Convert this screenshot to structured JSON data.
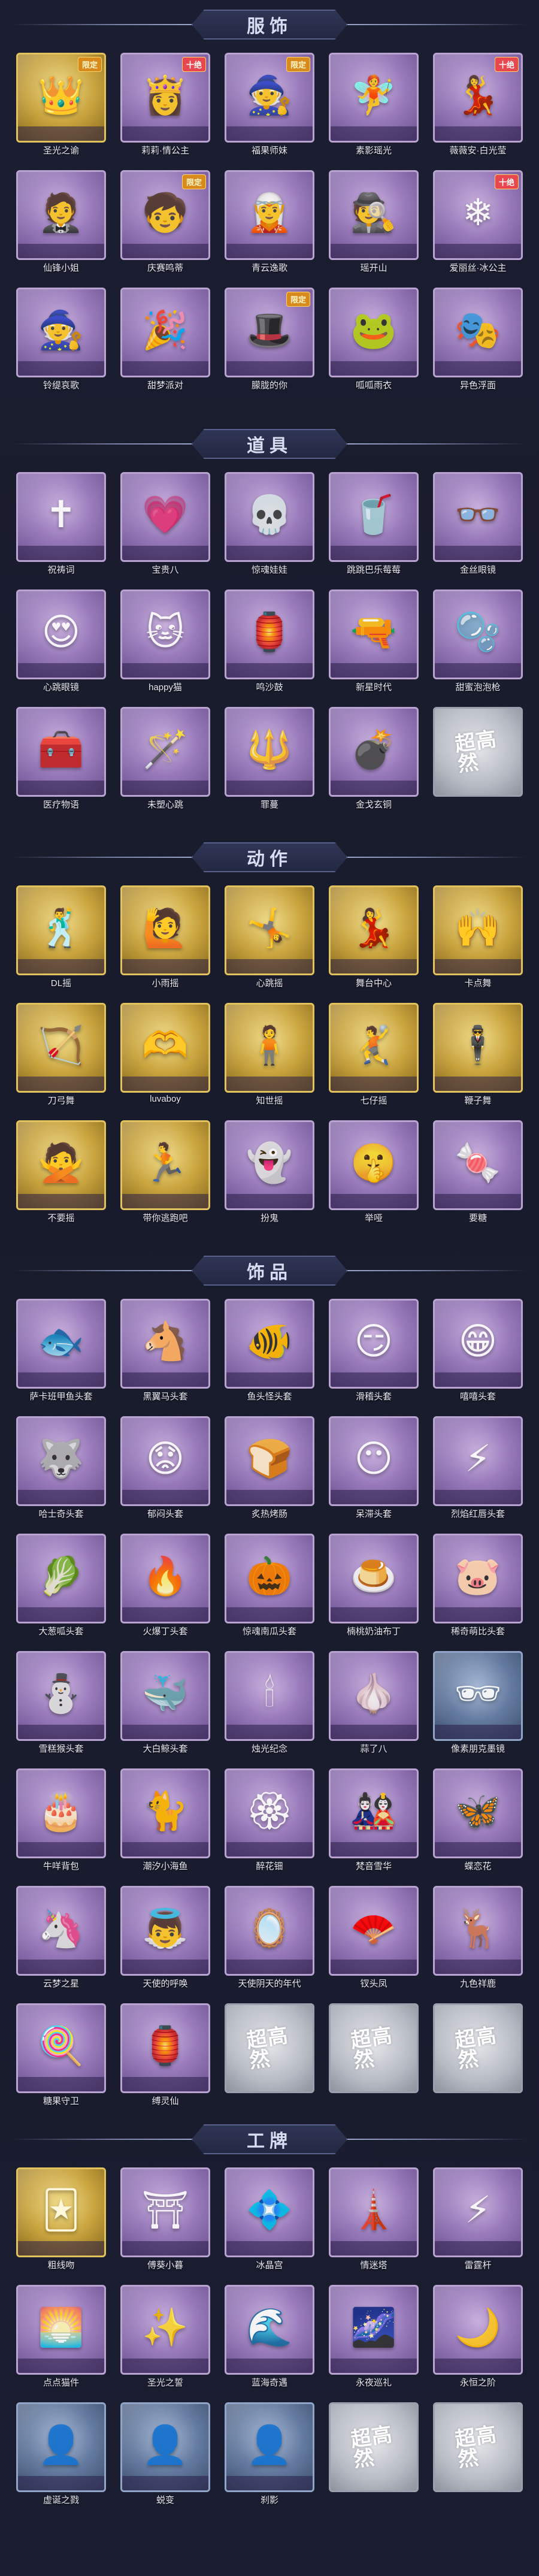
{
  "colors": {
    "background": "#181b2b",
    "epic_frame": "#b9a4d1",
    "legend_frame": "#e2c25c",
    "rare_frame": "#8fa4c6",
    "empty_frame": "#9aa0ad"
  },
  "empty_slot_text": "超高然",
  "sections": [
    {
      "title": "服饰",
      "items": [
        {
          "label": "圣光之谕",
          "rarity": "gold",
          "icon": "crown-icon",
          "glyph": "👑",
          "badge": "限定"
        },
        {
          "label": "莉莉·情公主",
          "rarity": "purple",
          "icon": "princess-icon",
          "glyph": "👸",
          "badge": "十绝"
        },
        {
          "label": "福果师妹",
          "rarity": "purple",
          "icon": "witch-hat-icon",
          "glyph": "🧙",
          "badge": "限定"
        },
        {
          "label": "素影瑶光",
          "rarity": "purple",
          "icon": "fairy-icon",
          "glyph": "🧚",
          "badge": ""
        },
        {
          "label": "薇薇安·白光莹",
          "rarity": "purple",
          "icon": "lady-icon",
          "glyph": "💃",
          "badge": "十绝"
        },
        {
          "label": "仙锋小姐",
          "rarity": "purple",
          "icon": "gentleman-icon",
          "glyph": "🤵",
          "badge": ""
        },
        {
          "label": "庆赛鸣蒂",
          "rarity": "purple",
          "icon": "child-icon",
          "glyph": "🧒",
          "badge": "限定"
        },
        {
          "label": "青云逸歌",
          "rarity": "purple",
          "icon": "elf-icon",
          "glyph": "🧝",
          "badge": ""
        },
        {
          "label": "瑶开山",
          "rarity": "purple",
          "icon": "hat-man-icon",
          "glyph": "🕵",
          "badge": ""
        },
        {
          "label": "爱丽丝·冰公主",
          "rarity": "purple",
          "icon": "ice-princess-icon",
          "glyph": "❄",
          "badge": "十绝"
        },
        {
          "label": "铃缇哀歌",
          "rarity": "purple",
          "icon": "mage-icon",
          "glyph": "🧙",
          "badge": ""
        },
        {
          "label": "甜梦派对",
          "rarity": "purple",
          "icon": "party-icon",
          "glyph": "🎉",
          "badge": ""
        },
        {
          "label": "朦胧的你",
          "rarity": "purple",
          "icon": "witch-icon",
          "glyph": "🎩",
          "badge": "限定"
        },
        {
          "label": "呱呱雨衣",
          "rarity": "purple",
          "icon": "frog-icon",
          "glyph": "🐸",
          "badge": ""
        },
        {
          "label": "异色浮面",
          "rarity": "purple",
          "icon": "mask-icon",
          "glyph": "🎭",
          "badge": ""
        }
      ]
    },
    {
      "title": "道具",
      "items": [
        {
          "label": "祝祷词",
          "rarity": "purple",
          "icon": "rosary-icon",
          "glyph": "✝",
          "badge": ""
        },
        {
          "label": "宝贵八",
          "rarity": "purple",
          "icon": "heart-mirror-icon",
          "glyph": "💗",
          "badge": ""
        },
        {
          "label": "惊魂娃娃",
          "rarity": "purple",
          "icon": "skull-icon",
          "glyph": "💀",
          "badge": ""
        },
        {
          "label": "跳跳巴乐莓莓",
          "rarity": "purple",
          "icon": "drink-icon",
          "glyph": "🥤",
          "badge": ""
        },
        {
          "label": "金丝眼镜",
          "rarity": "purple",
          "icon": "glasses-icon",
          "glyph": "👓",
          "badge": ""
        },
        {
          "label": "心跳眼镜",
          "rarity": "purple",
          "icon": "heart-glasses-icon",
          "glyph": "😍",
          "badge": ""
        },
        {
          "label": "happy猫",
          "rarity": "purple",
          "icon": "cat-icon",
          "glyph": "🐱",
          "badge": ""
        },
        {
          "label": "鸣沙鼓",
          "rarity": "purple",
          "icon": "lantern-icon",
          "glyph": "🏮",
          "badge": ""
        },
        {
          "label": "新星时代",
          "rarity": "purple",
          "icon": "revolver-icon",
          "glyph": "🔫",
          "badge": ""
        },
        {
          "label": "甜蜜泡泡枪",
          "rarity": "purple",
          "icon": "bubble-gun-icon",
          "glyph": "🫧",
          "badge": ""
        },
        {
          "label": "医疗物语",
          "rarity": "purple",
          "icon": "medkit-icon",
          "glyph": "🧰",
          "badge": ""
        },
        {
          "label": "未塑心跳",
          "rarity": "purple",
          "icon": "wand-icon",
          "glyph": "🪄",
          "badge": ""
        },
        {
          "label": "罪蔓",
          "rarity": "purple",
          "icon": "staff-icon",
          "glyph": "🔱",
          "badge": ""
        },
        {
          "label": "金戈玄铜",
          "rarity": "purple",
          "icon": "grenade-icon",
          "glyph": "💣",
          "badge": ""
        },
        {
          "label": "",
          "rarity": "empty",
          "icon": "empty-slot-icon",
          "glyph": "",
          "badge": ""
        }
      ]
    },
    {
      "title": "动作",
      "items": [
        {
          "label": "DL摇",
          "rarity": "gold",
          "icon": "dance-pose-icon",
          "glyph": "🕺",
          "badge": ""
        },
        {
          "label": "小雨摇",
          "rarity": "gold",
          "icon": "wave-pose-icon",
          "glyph": "🙋",
          "badge": ""
        },
        {
          "label": "心跳摇",
          "rarity": "gold",
          "icon": "heart-pose-icon",
          "glyph": "🤸",
          "badge": ""
        },
        {
          "label": "舞台中心",
          "rarity": "gold",
          "icon": "stage-pose-icon",
          "glyph": "💃",
          "badge": ""
        },
        {
          "label": "卡点舞",
          "rarity": "gold",
          "icon": "beat-pose-icon",
          "glyph": "🙌",
          "badge": ""
        },
        {
          "label": "刀弓舞",
          "rarity": "gold",
          "icon": "bow-pose-icon",
          "glyph": "🏹",
          "badge": ""
        },
        {
          "label": "luvaboy",
          "rarity": "gold",
          "icon": "love-pose-icon",
          "glyph": "🫶",
          "badge": ""
        },
        {
          "label": "知世摇",
          "rarity": "gold",
          "icon": "sway-pose-icon",
          "glyph": "🧍",
          "badge": ""
        },
        {
          "label": "七仔摇",
          "rarity": "gold",
          "icon": "jump-pose-icon",
          "glyph": "🤾",
          "badge": ""
        },
        {
          "label": "鞭子舞",
          "rarity": "gold",
          "icon": "whip-pose-icon",
          "glyph": "🕴",
          "badge": ""
        },
        {
          "label": "不要摇",
          "rarity": "gold",
          "icon": "refuse-pose-icon",
          "glyph": "🙅",
          "badge": ""
        },
        {
          "label": "带你逃跑吧",
          "rarity": "gold",
          "icon": "run-pose-icon",
          "glyph": "🏃",
          "badge": ""
        },
        {
          "label": "扮鬼",
          "rarity": "purple",
          "icon": "ghost-pose-icon",
          "glyph": "👻",
          "badge": ""
        },
        {
          "label": "举哑",
          "rarity": "purple",
          "icon": "mime-pose-icon",
          "glyph": "🤫",
          "badge": ""
        },
        {
          "label": "要糖",
          "rarity": "purple",
          "icon": "candy-pose-icon",
          "glyph": "🍬",
          "badge": ""
        }
      ]
    },
    {
      "title": "饰品",
      "items": [
        {
          "label": "萨卡班甲鱼头套",
          "rarity": "purple",
          "icon": "fish-head-icon",
          "glyph": "🐟",
          "badge": ""
        },
        {
          "label": "黑翼马头套",
          "rarity": "purple",
          "icon": "horse-head-icon",
          "glyph": "🐴",
          "badge": ""
        },
        {
          "label": "鱼头怪头套",
          "rarity": "purple",
          "icon": "fish-monster-icon",
          "glyph": "🐠",
          "badge": ""
        },
        {
          "label": "滑稽头套",
          "rarity": "purple",
          "icon": "funny-face-icon",
          "glyph": "😏",
          "badge": ""
        },
        {
          "label": "嘻嘻头套",
          "rarity": "purple",
          "icon": "grin-face-icon",
          "glyph": "😁",
          "badge": ""
        },
        {
          "label": "哈士奇头套",
          "rarity": "purple",
          "icon": "husky-head-icon",
          "glyph": "🐺",
          "badge": ""
        },
        {
          "label": "郁闷头套",
          "rarity": "purple",
          "icon": "sad-face-icon",
          "glyph": "😟",
          "badge": ""
        },
        {
          "label": "炙热烤肠",
          "rarity": "purple",
          "icon": "toast-head-icon",
          "glyph": "🍞",
          "badge": ""
        },
        {
          "label": "呆滞头套",
          "rarity": "purple",
          "icon": "blank-face-icon",
          "glyph": "😶",
          "badge": ""
        },
        {
          "label": "烈焰红唇头套",
          "rarity": "purple",
          "icon": "pikachu-head-icon",
          "glyph": "⚡",
          "badge": ""
        },
        {
          "label": "大葱呱头套",
          "rarity": "purple",
          "icon": "onion-head-icon",
          "glyph": "🥬",
          "badge": ""
        },
        {
          "label": "火爆丁头套",
          "rarity": "purple",
          "icon": "fire-head-icon",
          "glyph": "🔥",
          "badge": ""
        },
        {
          "label": "惊魂南瓜头套",
          "rarity": "purple",
          "icon": "pumpkin-head-icon",
          "glyph": "🎃",
          "badge": ""
        },
        {
          "label": "楠桃奶油布丁",
          "rarity": "purple",
          "icon": "pudding-head-icon",
          "glyph": "🍮",
          "badge": ""
        },
        {
          "label": "稀奇萌比头套",
          "rarity": "purple",
          "icon": "pig-head-icon",
          "glyph": "🐷",
          "badge": ""
        },
        {
          "label": "雪糕猴头套",
          "rarity": "purple",
          "icon": "snowman-head-icon",
          "glyph": "⛄",
          "badge": ""
        },
        {
          "label": "大白鲸头套",
          "rarity": "purple",
          "icon": "whale-head-icon",
          "glyph": "🐳",
          "badge": ""
        },
        {
          "label": "烛光纪念",
          "rarity": "purple",
          "icon": "candle-head-icon",
          "glyph": "🕯",
          "badge": ""
        },
        {
          "label": "蒜了八",
          "rarity": "purple",
          "icon": "garlic-head-icon",
          "glyph": "🧄",
          "badge": ""
        },
        {
          "label": "像素朋克墨镜",
          "rarity": "blue",
          "icon": "pixel-glasses-icon",
          "glyph": "🕶",
          "badge": ""
        },
        {
          "label": "牛咩背包",
          "rarity": "purple",
          "icon": "cake-backpack-icon",
          "glyph": "🎂",
          "badge": ""
        },
        {
          "label": "潮汐小海鱼",
          "rarity": "purple",
          "icon": "blue-cat-icon",
          "glyph": "🐈",
          "badge": ""
        },
        {
          "label": "醉花钿",
          "rarity": "purple",
          "icon": "hairpin-icon",
          "glyph": "🏵",
          "badge": ""
        },
        {
          "label": "梵音雪华",
          "rarity": "purple",
          "icon": "doll-icon",
          "glyph": "🎎",
          "badge": ""
        },
        {
          "label": "蝶恋花",
          "rarity": "purple",
          "icon": "butterfly-icon",
          "glyph": "🦋",
          "badge": ""
        },
        {
          "label": "云梦之星",
          "rarity": "purple",
          "icon": "unicorn-icon",
          "glyph": "🦄",
          "badge": ""
        },
        {
          "label": "天使的呼唤",
          "rarity": "purple",
          "icon": "angel-icon",
          "glyph": "👼",
          "badge": ""
        },
        {
          "label": "天使阴天的年代",
          "rarity": "purple",
          "icon": "mirror-icon",
          "glyph": "🪞",
          "badge": ""
        },
        {
          "label": "钗头凤",
          "rarity": "purple",
          "icon": "phoenix-pin-icon",
          "glyph": "🪭",
          "badge": ""
        },
        {
          "label": "九色祥鹿",
          "rarity": "purple",
          "icon": "deer-icon",
          "glyph": "🦌",
          "badge": ""
        },
        {
          "label": "糖果守卫",
          "rarity": "purple",
          "icon": "candy-guard-icon",
          "glyph": "🍭",
          "badge": ""
        },
        {
          "label": "缚灵仙",
          "rarity": "purple",
          "icon": "lantern-charm-icon",
          "glyph": "🏮",
          "badge": ""
        },
        {
          "label": "",
          "rarity": "empty",
          "icon": "empty-slot-icon",
          "glyph": "",
          "badge": ""
        },
        {
          "label": "",
          "rarity": "empty",
          "icon": "empty-slot-icon",
          "glyph": "",
          "badge": ""
        },
        {
          "label": "",
          "rarity": "empty",
          "icon": "empty-slot-icon",
          "glyph": "",
          "badge": ""
        }
      ]
    },
    {
      "title": "工牌",
      "items": [
        {
          "label": "粗线吻",
          "rarity": "gold",
          "icon": "card-frame-icon",
          "glyph": "🃏",
          "badge": ""
        },
        {
          "label": "傅葵小暮",
          "rarity": "purple",
          "icon": "gate-frame-icon",
          "glyph": "⛩",
          "badge": ""
        },
        {
          "label": "冰晶宫",
          "rarity": "purple",
          "icon": "crystal-frame-icon",
          "glyph": "💠",
          "badge": ""
        },
        {
          "label": "情迷塔",
          "rarity": "purple",
          "icon": "tower-frame-icon",
          "glyph": "🗼",
          "badge": ""
        },
        {
          "label": "雷霆杆",
          "rarity": "purple",
          "icon": "thunder-frame-icon",
          "glyph": "⚡",
          "badge": ""
        },
        {
          "label": "点点猫件",
          "rarity": "purple",
          "icon": "sunset-frame-icon",
          "glyph": "🌅",
          "badge": ""
        },
        {
          "label": "圣光之誓",
          "rarity": "purple",
          "icon": "holy-frame-icon",
          "glyph": "✨",
          "badge": ""
        },
        {
          "label": "蓝海奇遇",
          "rarity": "purple",
          "icon": "ocean-frame-icon",
          "glyph": "🌊",
          "badge": ""
        },
        {
          "label": "永夜巡礼",
          "rarity": "purple",
          "icon": "night-frame-icon",
          "glyph": "🌌",
          "badge": ""
        },
        {
          "label": "永恒之阶",
          "rarity": "purple",
          "icon": "moon-frame-icon",
          "glyph": "🌙",
          "badge": ""
        },
        {
          "label": "虚诞之戮",
          "rarity": "blue",
          "icon": "silhouette-frame-icon",
          "glyph": "👤",
          "badge": ""
        },
        {
          "label": "蜕变",
          "rarity": "blue",
          "icon": "shadow-frame-icon",
          "glyph": "👤",
          "badge": ""
        },
        {
          "label": "刹影",
          "rarity": "blue",
          "icon": "profile-frame-icon",
          "glyph": "👤",
          "badge": ""
        },
        {
          "label": "",
          "rarity": "empty",
          "icon": "empty-slot-icon",
          "glyph": "",
          "badge": ""
        },
        {
          "label": "",
          "rarity": "empty",
          "icon": "empty-slot-icon",
          "glyph": "",
          "badge": ""
        }
      ]
    }
  ]
}
